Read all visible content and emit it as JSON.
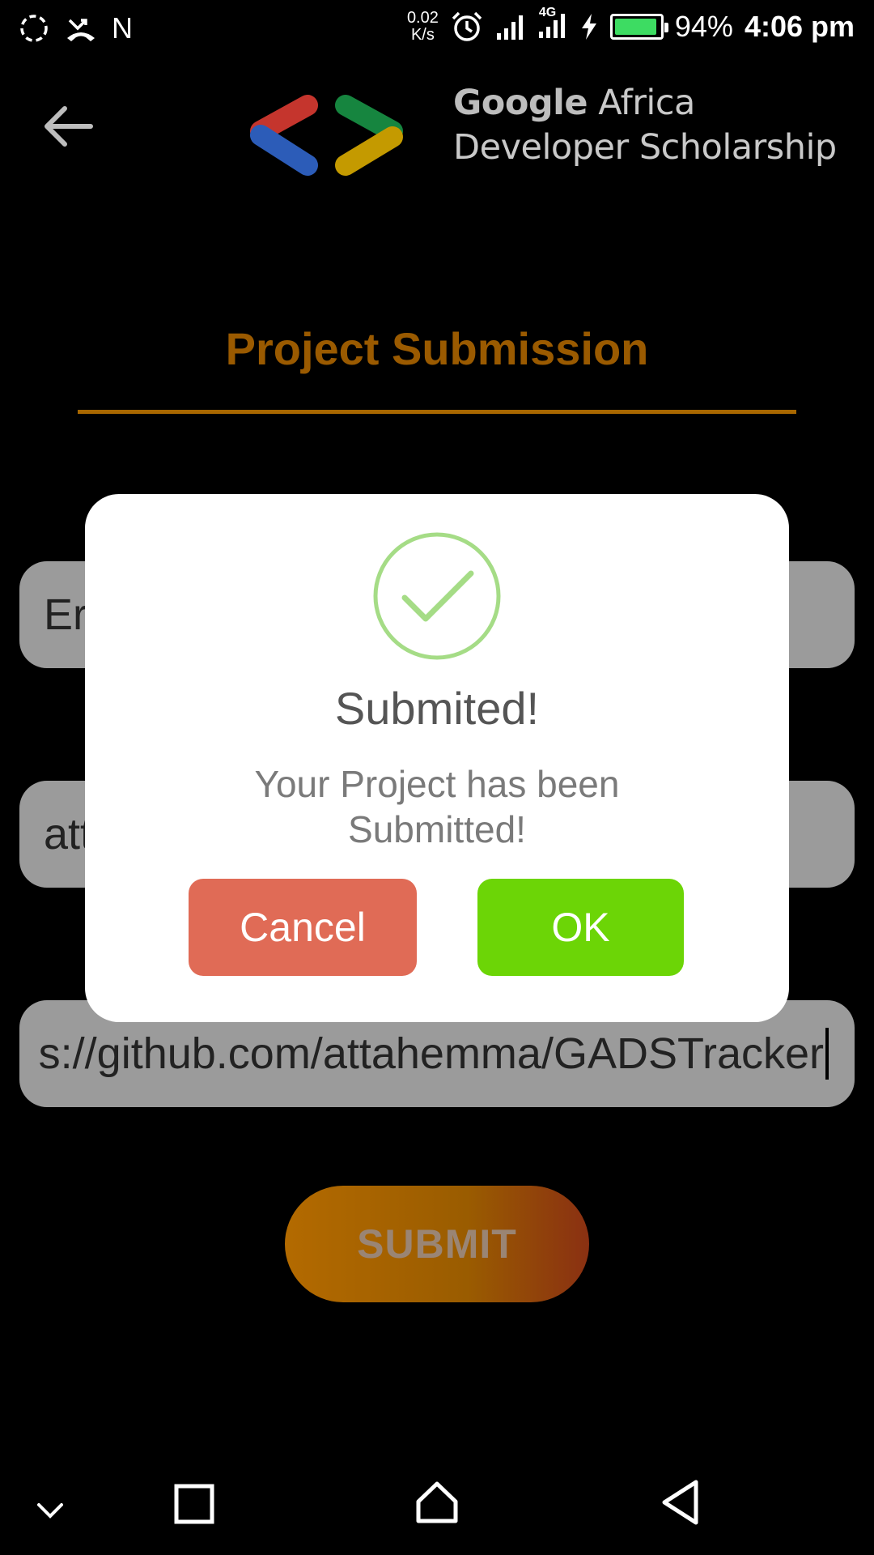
{
  "status_bar": {
    "carrier_letter": "N",
    "net_speed_value": "0.02",
    "net_speed_unit": "K/s",
    "network_type": "4G",
    "battery_percent": "94%",
    "battery_level": 0.94,
    "time": "4:06 pm"
  },
  "header": {
    "brand_google": "Google",
    "brand_africa": "Africa",
    "brand_line2": "Developer Scholarship",
    "logo_colors": [
      "#c5352d",
      "#2c5cb8",
      "#16853f",
      "#c49a00"
    ]
  },
  "page": {
    "title": "Project Submission"
  },
  "form": {
    "field1_partial": "Er",
    "field2_partial": "att",
    "field3_value": "s://github.com/attahemma/GADSTracker",
    "submit_label": "SUBMIT"
  },
  "dialog": {
    "title": "Submited!",
    "message": "Your Project has been Submitted!",
    "cancel_label": "Cancel",
    "ok_label": "OK",
    "success_color": "#a5dc86"
  },
  "icons": {
    "back": "arrow-left-icon",
    "check": "check-circle-icon",
    "nav_down": "chevron-down-icon",
    "nav_recents": "square-icon",
    "nav_home": "home-icon",
    "nav_back": "triangle-back-icon"
  }
}
